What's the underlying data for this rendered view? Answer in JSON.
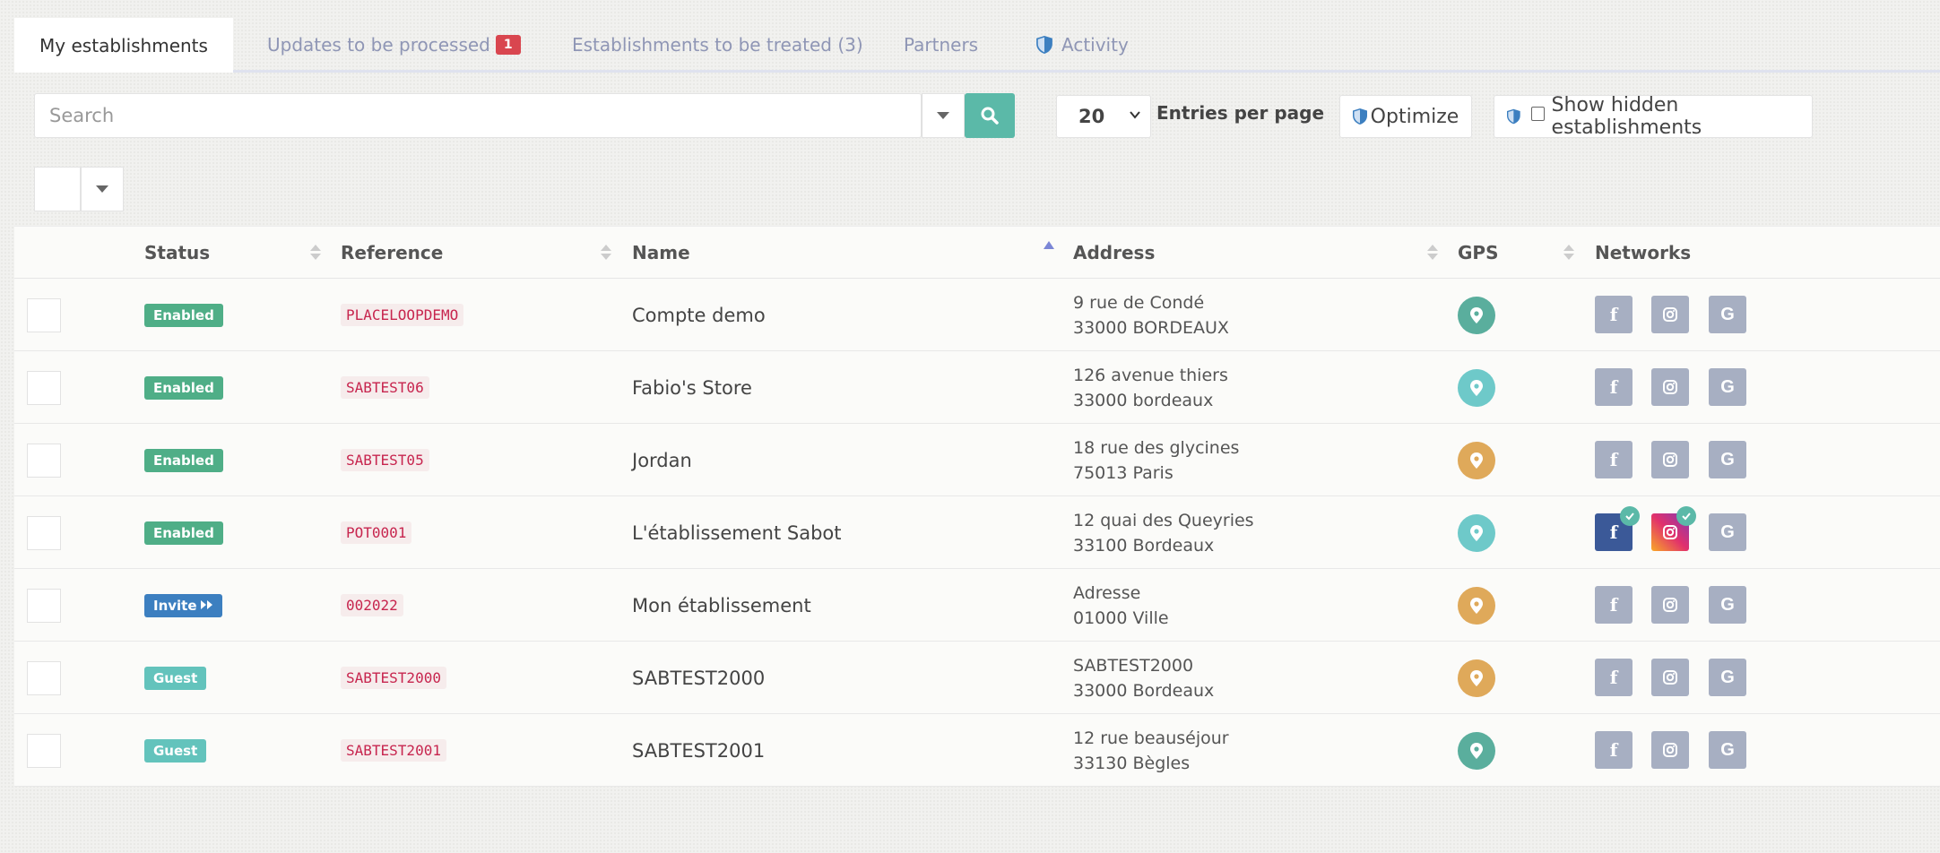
{
  "tabs": [
    {
      "label": "My establishments",
      "active": true
    },
    {
      "label": "Updates to be processed",
      "badge": "1"
    },
    {
      "label": "Establishments to be treated (3)"
    },
    {
      "label": "Partners"
    },
    {
      "label": "Activity",
      "icon": "shield-icon"
    }
  ],
  "toolbar": {
    "search_placeholder": "Search",
    "per_page_value": "20",
    "per_page_label": "Entries per page",
    "optimize_label": "Optimize",
    "show_hidden_label": "Show hidden establishments"
  },
  "table": {
    "columns": [
      "Status",
      "Reference",
      "Name",
      "Address",
      "GPS",
      "Networks"
    ],
    "sorted_column": "Name",
    "rows": [
      {
        "status": "Enabled",
        "status_kind": "enabled",
        "reference": "PLACELOOPDEMO",
        "name": "Compte demo",
        "address1": "9 rue de Condé",
        "address2": "33000 BORDEAUX",
        "gps": "green",
        "fb_verified": false,
        "ig_verified": false
      },
      {
        "status": "Enabled",
        "status_kind": "enabled",
        "reference": "SABTEST06",
        "name": "Fabio's Store",
        "address1": "126 avenue thiers",
        "address2": "33000 bordeaux",
        "gps": "teal",
        "fb_verified": false,
        "ig_verified": false
      },
      {
        "status": "Enabled",
        "status_kind": "enabled",
        "reference": "SABTEST05",
        "name": "Jordan",
        "address1": "18 rue des glycines",
        "address2": "75013 Paris",
        "gps": "orange",
        "fb_verified": false,
        "ig_verified": false
      },
      {
        "status": "Enabled",
        "status_kind": "enabled",
        "reference": "POT0001",
        "name": "L'établissement Sabot",
        "address1": "12 quai des Queyries",
        "address2": "33100 Bordeaux",
        "gps": "teal",
        "fb_verified": true,
        "ig_verified": true
      },
      {
        "status": "Invite",
        "status_kind": "invite",
        "reference": "002022",
        "name": "Mon établissement",
        "address1": "Adresse",
        "address2": "01000 Ville",
        "gps": "orange",
        "fb_verified": false,
        "ig_verified": false
      },
      {
        "status": "Guest",
        "status_kind": "guest",
        "reference": "SABTEST2000",
        "name": "SABTEST2000",
        "address1": "SABTEST2000",
        "address2": "33000 Bordeaux",
        "gps": "orange",
        "fb_verified": false,
        "ig_verified": false
      },
      {
        "status": "Guest",
        "status_kind": "guest",
        "reference": "SABTEST2001",
        "name": "SABTEST2001",
        "address1": "12 rue beauséjour",
        "address2": "33130 Bègles",
        "gps": "green",
        "fb_verified": false,
        "ig_verified": false
      }
    ]
  },
  "colors": {
    "enabled": "#4fae87",
    "invite": "#3c7fc0",
    "guest": "#63c3bc",
    "gps_green": "#5aae9d",
    "gps_teal": "#6ec9c9",
    "gps_orange": "#dfa95a",
    "search_button": "#5bb9a8"
  }
}
